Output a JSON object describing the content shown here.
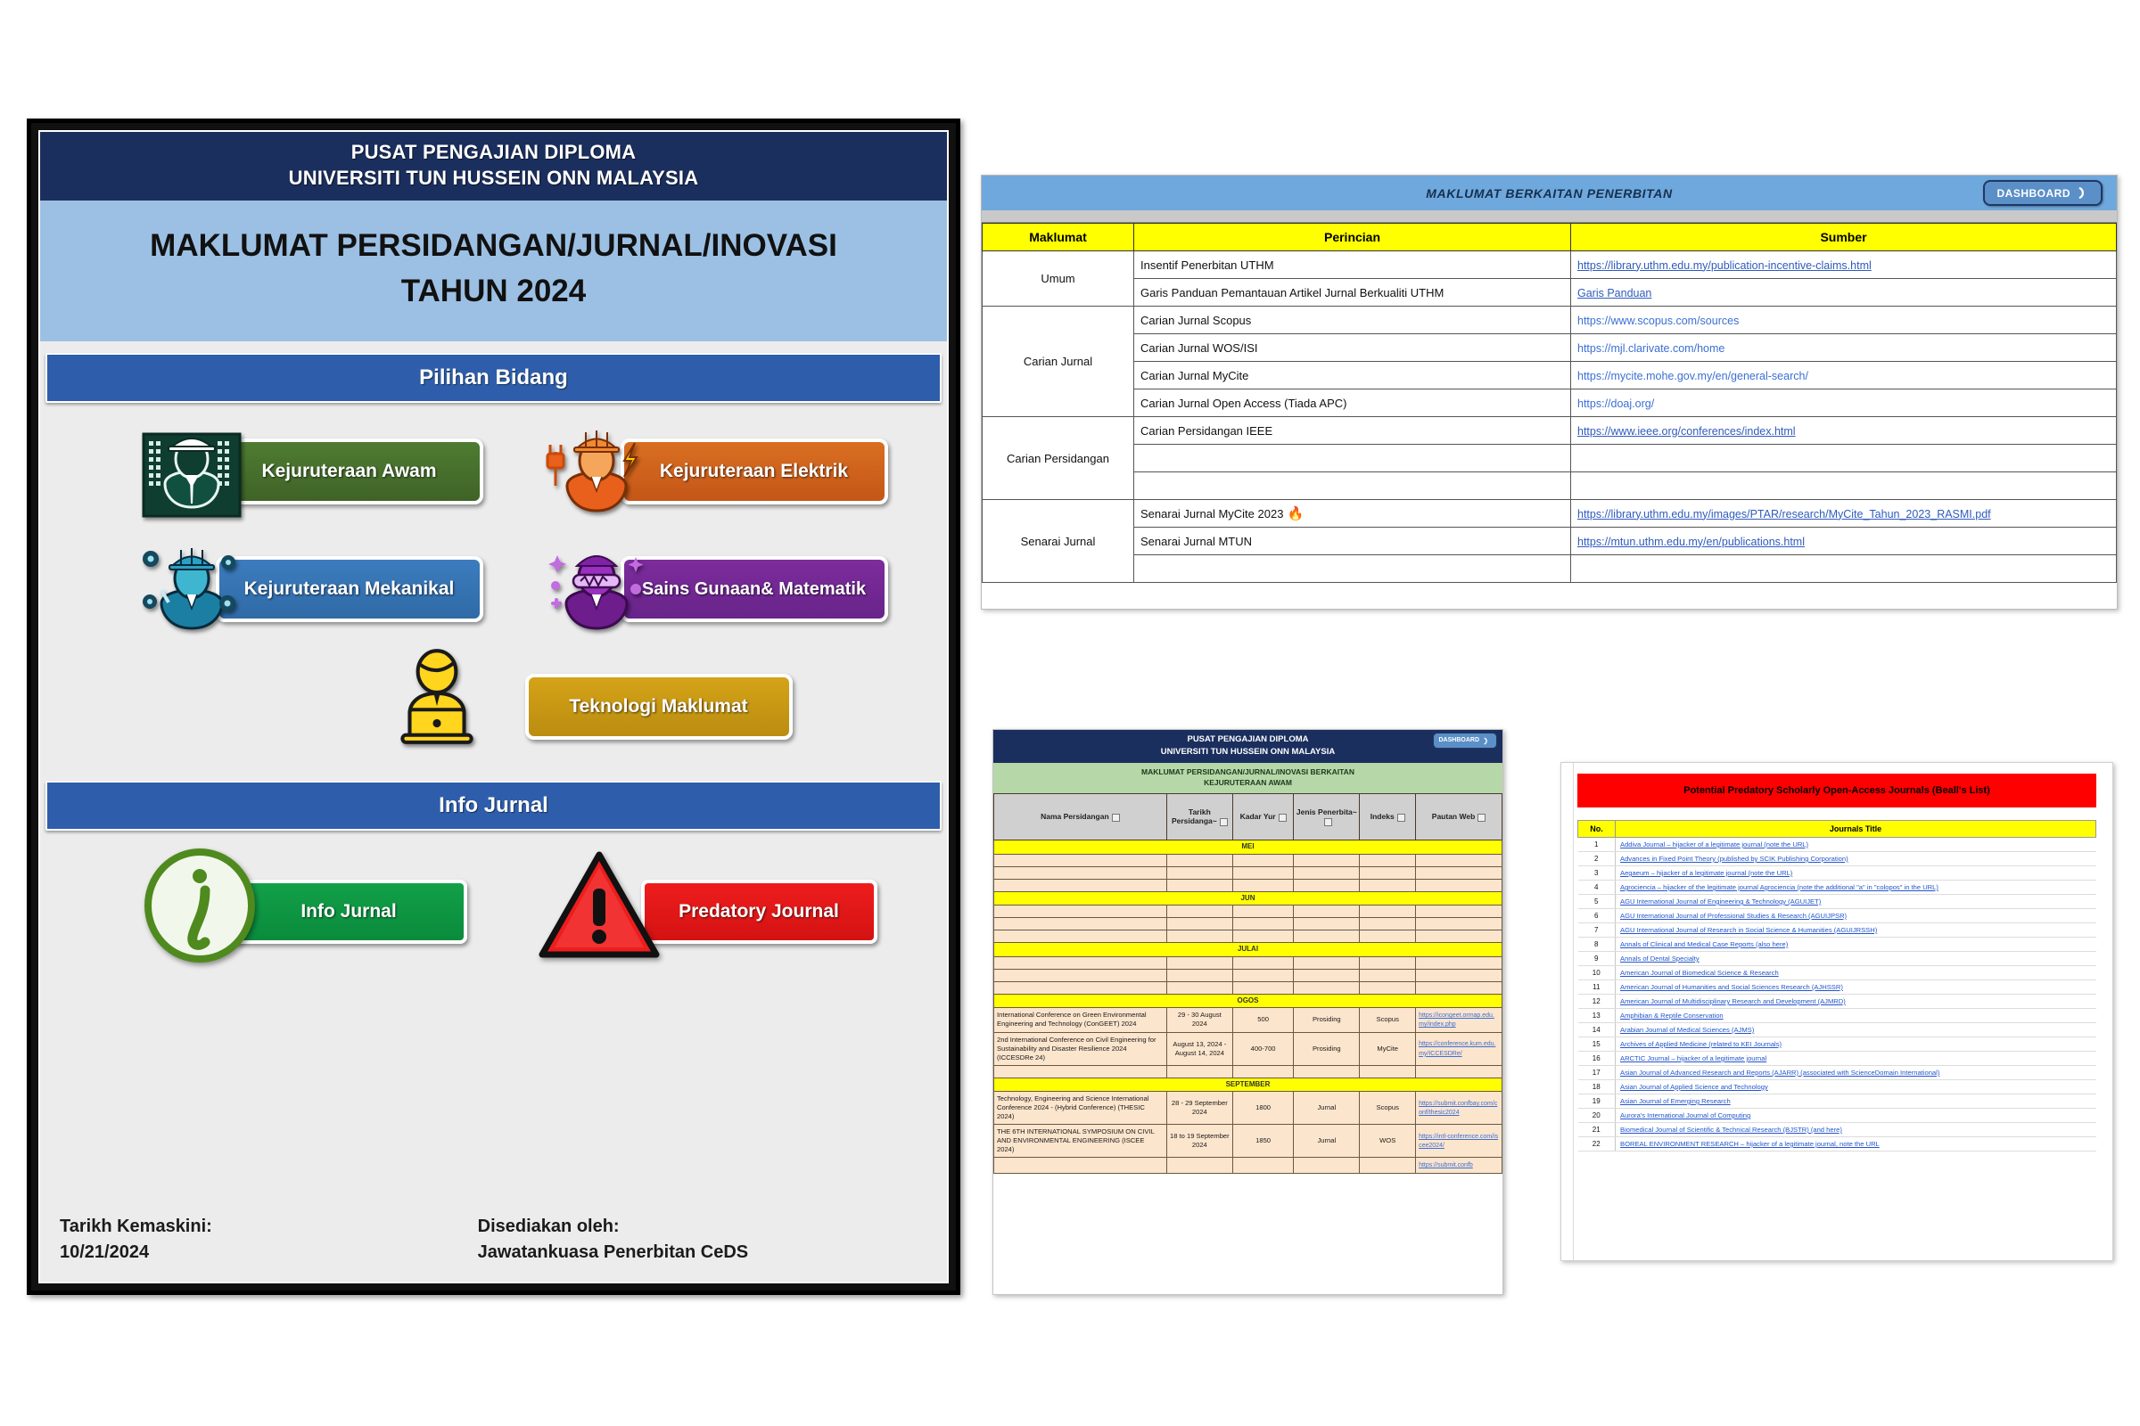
{
  "dashboard": {
    "title_line1": "PUSAT PENGAJIAN DIPLOMA",
    "title_line2": "UNIVERSITI TUN HUSSEIN ONN MALAYSIA",
    "main_title_line1": "MAKLUMAT PERSIDANGAN/JURNAL/INOVASI",
    "main_title_line2": "TAHUN 2024",
    "section_bidang": "Pilihan Bidang",
    "section_info": "Info Jurnal",
    "fields": [
      {
        "label": "Kejuruteraan Awam",
        "icon": "civil-engineer-icon",
        "color": "#4e7c31"
      },
      {
        "label": "Kejuruteraan Elektrik",
        "icon": "electrical-engineer-icon",
        "color": "#d96f22"
      },
      {
        "label": "Kejuruteraan Mekanikal",
        "icon": "mechanical-engineer-icon",
        "color": "#3c7cbe"
      },
      {
        "label_line1": "Sains Gunaan",
        "label_line2": "& Matematik",
        "icon": "science-math-icon",
        "color": "#7d2c9c"
      },
      {
        "label": "Teknologi Maklumat",
        "icon": "it-laptop-icon",
        "color": "#d4a318"
      }
    ],
    "info_buttons": [
      {
        "label": "Info Jurnal",
        "icon": "info-circle-icon",
        "color": "#12a048"
      },
      {
        "label": "Predatory Journal",
        "icon": "warning-triangle-icon",
        "color": "#ee1d1d"
      }
    ],
    "footer": {
      "update_label": "Tarikh Kemaskini:",
      "update_date": "10/21/2024",
      "prepared_label": "Disediakan oleh:",
      "prepared_by": "Jawatankuasa Penerbitan CeDS"
    }
  },
  "publication_table": {
    "banner": "MAKLUMAT BERKAITAN PENERBITAN",
    "dashboard_chip": "DASHBOARD",
    "headers": [
      "Maklumat",
      "Perincian",
      "Sumber"
    ],
    "groups": [
      {
        "name": "Umum",
        "rows": [
          {
            "perincian": "Insentif Penerbitan UTHM",
            "sumber": "https://library.uthm.edu.my/publication-incentive-claims.html",
            "is_link": true
          },
          {
            "perincian": "Garis Panduan Pemantauan Artikel Jurnal Berkualiti UTHM",
            "sumber": "Garis Panduan",
            "is_link": true
          }
        ]
      },
      {
        "name": "Carian Jurnal",
        "rows": [
          {
            "perincian": "Carian Jurnal Scopus",
            "sumber": "https://www.scopus.com/sources",
            "is_link": false
          },
          {
            "perincian": "Carian Jurnal WOS/ISI",
            "sumber": "https://mjl.clarivate.com/home",
            "is_link": false
          },
          {
            "perincian": "Carian Jurnal MyCite",
            "sumber": "https://mycite.mohe.gov.my/en/general-search/",
            "is_link": false
          },
          {
            "perincian": "Carian Jurnal Open Access (Tiada APC)",
            "sumber": "https://doaj.org/",
            "is_link": false
          }
        ]
      },
      {
        "name": "Carian Persidangan",
        "rows": [
          {
            "perincian": "Carian Persidangan IEEE",
            "sumber": "https://www.ieee.org/conferences/index.html",
            "is_link": true
          },
          {
            "perincian": "",
            "sumber": "",
            "is_link": false
          },
          {
            "perincian": "",
            "sumber": "",
            "is_link": false
          }
        ]
      },
      {
        "name": "Senarai Jurnal",
        "rows": [
          {
            "perincian": "Senarai Jurnal MyCite 2023",
            "fire": "🔥",
            "sumber": "https://library.uthm.edu.my/images/PTAR/research/MyCite_Tahun_2023_RASMI.pdf",
            "is_link": true
          },
          {
            "perincian": "Senarai Jurnal MTUN",
            "sumber": "https://mtun.uthm.edu.my/en/publications.html",
            "is_link": true
          },
          {
            "perincian": "",
            "sumber": "",
            "is_link": false
          }
        ]
      }
    ]
  },
  "conference_table": {
    "header_line1": "PUSAT PENGAJIAN DIPLOMA",
    "header_line2": "UNIVERSITI TUN HUSSEIN ONN MALAYSIA",
    "dashboard_chip": "DASHBOARD",
    "subheader_line1": "MAKLUMAT PERSIDANGAN/JURNAL/INOVASI BERKAITAN",
    "subheader_line2": "KEJURUTERAAN AWAM",
    "columns": [
      "Nama Persidangan",
      "Tarikh Persidanga~",
      "Kadar Yur",
      "Jenis Penerbita~",
      "Indeks",
      "Pautan Web"
    ],
    "sections": [
      {
        "month": "MEI",
        "rows": [
          {
            "blank": true
          },
          {
            "blank": true
          },
          {
            "blank": true
          }
        ]
      },
      {
        "month": "JUN",
        "rows": [
          {
            "blank": true
          },
          {
            "blank": true
          },
          {
            "blank": true
          }
        ]
      },
      {
        "month": "JULAI",
        "rows": [
          {
            "blank": true
          },
          {
            "blank": true
          },
          {
            "blank": true
          }
        ]
      },
      {
        "month": "OGOS",
        "rows": [
          {
            "nama": "International Conference on Green Environmental Engineering and Technology (ConGEET) 2024",
            "tarikh": "29 - 30 August 2024",
            "kadar": "500",
            "jenis": "Prosiding",
            "indeks": "Scopus",
            "pautan": "https://icongeet.ormap.edu.my/index.php"
          },
          {
            "nama": "2nd International Conference on Civil Engineering for Sustainability and Disaster Resilience 2024 (ICCESDRe 24)",
            "tarikh": "August 13, 2024 - August 14, 2024",
            "kadar": "400-700",
            "jenis": "Prosiding",
            "indeks": "MyCite",
            "pautan": "https://conference.kum.edu.my/ICCESDRe/"
          },
          {
            "blank": true
          }
        ]
      },
      {
        "month": "SEPTEMBER",
        "rows": [
          {
            "nama": "Technology, Engineering and Science International Conference 2024 - (Hybrid Conference) (THESIC 2024)",
            "tarikh": "28 - 29 September 2024",
            "kadar": "1800",
            "jenis": "Jurnal",
            "indeks": "Scopus",
            "pautan": "https://submit.confbay.com/conf/thesic2024"
          },
          {
            "nama": "THE 6TH INTERNATIONAL SYMPOSIUM ON CIVIL AND ENVIRONMENTAL ENGINEERING (ISCEE 2024)",
            "tarikh": "18 to 19 September 2024",
            "kadar": "1850",
            "jenis": "Jurnal",
            "indeks": "WOS",
            "pautan": "https://intl-conference.com/iscee2024/"
          },
          {
            "nama": "",
            "tarikh": "",
            "kadar": "",
            "jenis": "",
            "indeks": "",
            "pautan": "https://submit.confb"
          }
        ]
      }
    ]
  },
  "predatory_table": {
    "title": "Potential Predatory Scholarly Open-Access Journals (Beall's List)",
    "headers": [
      "No.",
      "Journals Title"
    ],
    "rows": [
      {
        "no": "1",
        "title": "Addiva Journal – hijacker of a legitimate journal (note the URL)"
      },
      {
        "no": "2",
        "title": "Advances in Fixed Point Theory (published by SCIK Publishing Corporation)"
      },
      {
        "no": "3",
        "title": "Aegaeum – hijacker of a legitimate journal (note the URL)"
      },
      {
        "no": "4",
        "title": "Agrociencia – hijacker of the legitimate journal Agrociencia (note the additional \"a\" in \"colopos\" in the URL)"
      },
      {
        "no": "5",
        "title": "AGU International Journal of Engineering & Technology (AGUIJET)"
      },
      {
        "no": "6",
        "title": "AGU International Journal of Professional Studies & Research (AGUIJPSR)"
      },
      {
        "no": "7",
        "title": "AGU International Journal of Research in Social Science & Humanities (AGUIJRSSH)"
      },
      {
        "no": "8",
        "title": "Annals of Clinical and Medical Case Reports (also here)"
      },
      {
        "no": "9",
        "title": "Annals of Dental Specialty"
      },
      {
        "no": "10",
        "title": "American Journal of Biomedical Science & Research"
      },
      {
        "no": "11",
        "title": "American Journal of Humanities and Social Sciences Research (AJHSSR)"
      },
      {
        "no": "12",
        "title": "American Journal of Multidisciplinary Research and Development (AJMRD)"
      },
      {
        "no": "13",
        "title": "Amphibian & Reptile Conservation"
      },
      {
        "no": "14",
        "title": "Arabian Journal of Medical Sciences (AJMS)"
      },
      {
        "no": "15",
        "title": "Archives of Applied Medicine (related to KEI Journals)"
      },
      {
        "no": "16",
        "title": "ARCTIC Journal – hijacker of a legitimate journal"
      },
      {
        "no": "17",
        "title": "Asian Journal of Advanced Research and Reports (AJARR) (associated with ScienceDomain International)"
      },
      {
        "no": "18",
        "title": "Asian Journal of Applied Science and Technology"
      },
      {
        "no": "19",
        "title": "Asian Journal of Emerging Research"
      },
      {
        "no": "20",
        "title": "Aurora's International Journal of Computing"
      },
      {
        "no": "21",
        "title": "Biomedical Journal of Scientific & Technical Research (BJSTR) (and here)"
      },
      {
        "no": "22",
        "title": "BOREAL ENVIRONMENT RESEARCH – hijacker of a legitimate journal, note the URL"
      }
    ]
  }
}
